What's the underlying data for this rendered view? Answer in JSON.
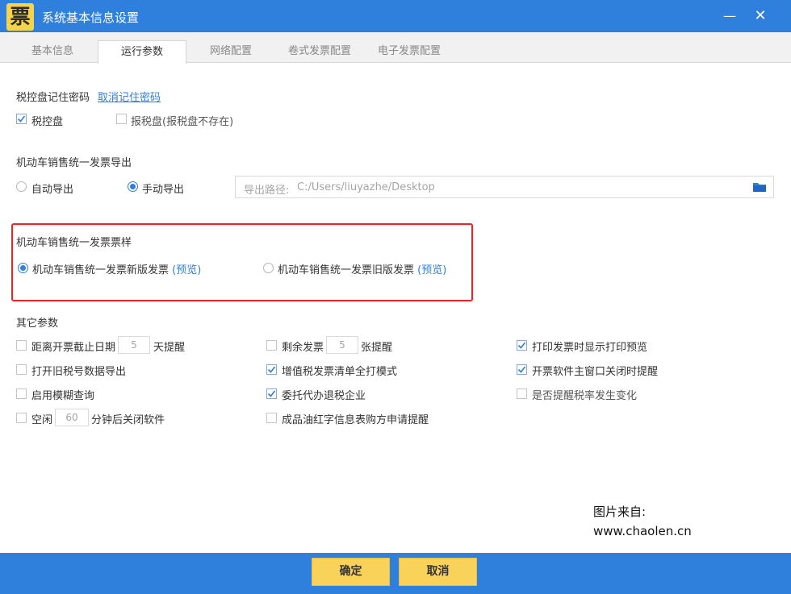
{
  "window": {
    "title": "系统基本信息设置",
    "app_icon_char": "票",
    "minimize": "—",
    "close": "✕",
    "accent_color": "#2f7fdc",
    "button_color": "#f9d25a"
  },
  "tabs": [
    {
      "label": "基本信息",
      "active": false
    },
    {
      "label": "运行参数",
      "active": true
    },
    {
      "label": "网络配置",
      "active": false
    },
    {
      "label": "卷式发票配置",
      "active": false
    },
    {
      "label": "电子发票配置",
      "active": false
    }
  ],
  "tax_disk": {
    "title": "税控盘记住密码",
    "cancel_link": "取消记住密码",
    "options": [
      {
        "label": "税控盘",
        "checked": true
      },
      {
        "label": "报税盘(报税盘不存在)",
        "checked": false
      }
    ]
  },
  "vehicle_export": {
    "title": "机动车销售统一发票导出",
    "options": [
      {
        "label": "自动导出",
        "selected": false
      },
      {
        "label": "手动导出",
        "selected": true
      }
    ],
    "path_label": "导出路径:",
    "path_value": "C:/Users/liuyazhe/Desktop",
    "folder_icon": "folder-icon"
  },
  "vehicle_template": {
    "title": "机动车销售统一发票票样",
    "options": [
      {
        "label": "机动车销售统一发票新版发票",
        "preview": "(预览)",
        "selected": true
      },
      {
        "label": "机动车销售统一发票旧版发票",
        "preview": "(预览)",
        "selected": false
      }
    ]
  },
  "other_params": {
    "title": "其它参数",
    "col1": [
      {
        "prefix": "距离开票截止日期",
        "value": "5",
        "suffix": "天提醒",
        "checked": false
      },
      {
        "label": "打开旧税号数据导出",
        "checked": false
      },
      {
        "label": "启用模糊查询",
        "checked": false
      },
      {
        "prefix": "空闲",
        "value": "60",
        "suffix": "分钟后关闭软件",
        "checked": false
      }
    ],
    "col2": [
      {
        "prefix": "剩余发票",
        "value": "5",
        "suffix": "张提醒",
        "checked": false
      },
      {
        "label": "增值税发票清单全打模式",
        "checked": true
      },
      {
        "label": "委托代办退税企业",
        "checked": true
      },
      {
        "label": "成品油红字信息表购方申请提醒",
        "checked": false
      }
    ],
    "col3": [
      {
        "label": "打印发票时显示打印预览",
        "checked": true
      },
      {
        "label": "开票软件主窗口关闭时提醒",
        "checked": true
      },
      {
        "label": "是否提醒税率发生变化",
        "checked": false
      }
    ]
  },
  "watermark": {
    "line1": "图片来自:",
    "line2": "www.chaolen.cn"
  },
  "footer": {
    "ok": "确定",
    "cancel": "取消"
  }
}
